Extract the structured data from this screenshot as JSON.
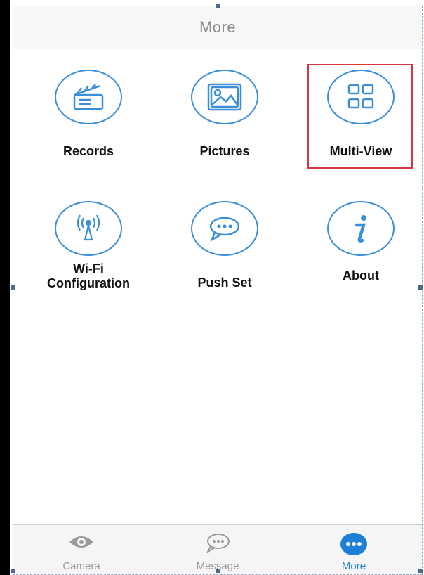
{
  "header": {
    "title": "More"
  },
  "grid": {
    "items": [
      {
        "label": "Records",
        "icon": "clapperboard-icon"
      },
      {
        "label": "Pictures",
        "icon": "picture-icon"
      },
      {
        "label": "Multi-View",
        "icon": "grid-icon"
      },
      {
        "label": "Wi-Fi\nConfiguration",
        "icon": "wifi-antenna-icon"
      },
      {
        "label": "Push Set",
        "icon": "chat-bubble-icon"
      },
      {
        "label": "About",
        "icon": "info-icon"
      }
    ]
  },
  "tabbar": {
    "tabs": [
      {
        "label": "Camera",
        "icon": "eye-icon"
      },
      {
        "label": "Message",
        "icon": "message-icon"
      },
      {
        "label": "More",
        "icon": "more-dots-icon"
      }
    ]
  },
  "colors": {
    "accent": "#3a8fd8",
    "active_tab": "#1e7fd6",
    "highlight_box": "#d9363e"
  }
}
